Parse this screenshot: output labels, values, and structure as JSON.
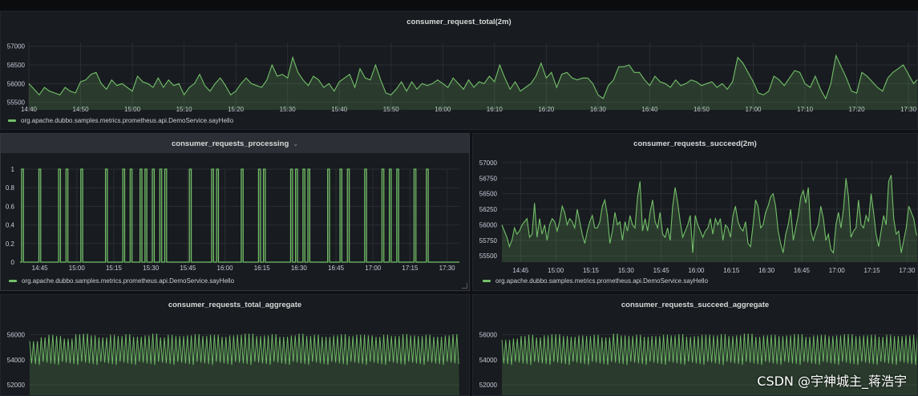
{
  "colors": {
    "series": "#73bf69",
    "fill": "rgba(115,191,105,0.20)",
    "background": "#111217",
    "panel": "#181b1f",
    "grid": "#2a2d33",
    "tick": "#ccccdc"
  },
  "legend_series": "org.apache.dubbo.samples.metrics.prometheus.api.DemoService.sayHello",
  "panel_menu_icon": "chevron-down-icon",
  "watermark": "CSDN @宇神城主_蒋浩宇",
  "chart_data": [
    {
      "id": "total",
      "type": "area",
      "title": "consumer_request_total(2m)",
      "xlabel": "",
      "ylabel": "",
      "x_ticks": [
        "14:40",
        "14:50",
        "15:00",
        "15:10",
        "15:20",
        "15:30",
        "15:40",
        "15:50",
        "16:00",
        "16:10",
        "16:20",
        "16:30",
        "16:40",
        "16:50",
        "17:00",
        "17:10",
        "17:20",
        "17:30"
      ],
      "y_ticks": [
        "55500",
        "56000",
        "56500",
        "57000"
      ],
      "ylim": [
        55300,
        57100
      ],
      "grid": true,
      "legend": "bottom-left",
      "series": [
        {
          "name": "org.apache.dubbo.samples.metrics.prometheus.api.DemoService.sayHello",
          "x_start": "14:40",
          "x_end": "17:32",
          "values": [
            56000,
            55850,
            55700,
            55900,
            55800,
            55750,
            55700,
            55900,
            55800,
            55750,
            56050,
            56100,
            56250,
            56300,
            56000,
            55850,
            56100,
            55950,
            56000,
            55900,
            55800,
            56200,
            56050,
            56000,
            55900,
            56150,
            55900,
            56100,
            55950,
            56000,
            55700,
            55900,
            56000,
            56250,
            55950,
            55800,
            56000,
            56150,
            55950,
            55700,
            55800,
            56000,
            56150,
            56000,
            55950,
            55900,
            56100,
            56500,
            56200,
            56250,
            56150,
            56700,
            56300,
            56100,
            55950,
            56200,
            56100,
            55900,
            56000,
            55800,
            56050,
            56150,
            56250,
            55900,
            56400,
            56150,
            56100,
            56500,
            56100,
            55750,
            55700,
            55850,
            56050,
            55800,
            56050,
            55850,
            56000,
            55950,
            56000,
            56100,
            56000,
            55900,
            56150,
            56000,
            55850,
            56100,
            55900,
            56050,
            56000,
            56200,
            56050,
            56500,
            56150,
            55850,
            56050,
            55800,
            55900,
            56000,
            56200,
            56550,
            56150,
            56300,
            55900,
            56250,
            56300,
            56150,
            56100,
            56150,
            56150,
            56000,
            55700,
            55600,
            55950,
            56100,
            56450,
            56450,
            56500,
            56300,
            56300,
            56100,
            55950,
            56200,
            56050,
            56000,
            55900,
            56100,
            55950,
            56000,
            56100,
            56050,
            55950,
            56000,
            56050,
            55900,
            56000,
            55850,
            56050,
            56700,
            56550,
            56300,
            56050,
            55750,
            55700,
            55800,
            56200,
            56100,
            55950,
            56150,
            56350,
            56300,
            56000,
            55900,
            56200,
            55850,
            55600,
            56000,
            56750,
            56450,
            56150,
            55800,
            55750,
            56300,
            56200,
            56050,
            55900,
            55800,
            56150,
            56300,
            56400,
            56500,
            56250,
            56000,
            56150
          ]
        }
      ]
    },
    {
      "id": "processing",
      "type": "line",
      "title": "consumer_requests_processing",
      "xlabel": "",
      "ylabel": "",
      "x_ticks": [
        "14:45",
        "15:00",
        "15:15",
        "15:30",
        "15:45",
        "16:00",
        "16:15",
        "16:30",
        "16:45",
        "17:00",
        "17:15",
        "17:30"
      ],
      "y_ticks": [
        "0",
        "0.2",
        "0.4",
        "0.6",
        "0.8",
        "1"
      ],
      "ylim": [
        0,
        1
      ],
      "grid": true,
      "legend": "bottom-left",
      "series": [
        {
          "name": "org.apache.dubbo.samples.metrics.prometheus.api.DemoService.sayHello",
          "x_start": "14:37",
          "x_end": "17:35",
          "spike_times": [
            "14:38",
            "14:45",
            "14:53",
            "14:56",
            "15:02",
            "15:12",
            "15:19",
            "15:22",
            "15:26",
            "15:28",
            "15:31",
            "15:34",
            "15:36",
            "15:46",
            "15:55",
            "15:57",
            "16:07",
            "16:14",
            "16:16",
            "16:27",
            "16:29",
            "16:32",
            "16:34",
            "16:42",
            "16:47",
            "16:50",
            "16:57",
            "17:04",
            "17:07",
            "17:10",
            "17:17",
            "17:22"
          ],
          "values": [
            1,
            1,
            1,
            1,
            1,
            1,
            1,
            1,
            1,
            1,
            1,
            1,
            1,
            1,
            1,
            1,
            1,
            1,
            1,
            1,
            1,
            1,
            1,
            1,
            1,
            1,
            1,
            1,
            1,
            1,
            1,
            1
          ],
          "baseline": 0
        }
      ]
    },
    {
      "id": "succeed",
      "type": "area",
      "title": "consumer_requests_succeed(2m)",
      "xlabel": "",
      "ylabel": "",
      "x_ticks": [
        "14:45",
        "15:00",
        "15:15",
        "15:30",
        "15:45",
        "16:00",
        "16:15",
        "16:30",
        "16:45",
        "17:00",
        "17:15",
        "17:30"
      ],
      "y_ticks": [
        "55500",
        "55750",
        "56000",
        "56250",
        "56500",
        "56750",
        "57000"
      ],
      "ylim": [
        55400,
        57050
      ],
      "grid": true,
      "legend": "bottom-left",
      "series": [
        {
          "name": "org.apache.dubbo.samples.metrics.prometheus.api.DemoService.sayHello",
          "x_start": "14:37",
          "x_end": "17:35",
          "values": [
            56000,
            55900,
            55800,
            55650,
            55750,
            55950,
            55850,
            55900,
            56000,
            56050,
            56100,
            55800,
            55850,
            56350,
            55800,
            56100,
            55850,
            56000,
            55750,
            56000,
            56100,
            56050,
            55900,
            56050,
            56300,
            56200,
            56000,
            56100,
            56050,
            55950,
            56250,
            56050,
            55850,
            55700,
            55900,
            56050,
            56150,
            55950,
            55950,
            56050,
            56300,
            56400,
            56150,
            55700,
            55900,
            56200,
            56000,
            56050,
            55750,
            56050,
            55900,
            56150,
            56000,
            55950,
            56450,
            56700,
            55900,
            56100,
            55900,
            56200,
            56400,
            56050,
            55950,
            56200,
            55850,
            55800,
            55950,
            55750,
            56300,
            56600,
            56350,
            56050,
            55800,
            55900,
            56000,
            56150,
            55550,
            56150,
            56000,
            55900,
            55800,
            55900,
            55950,
            56100,
            55850,
            56100,
            56000,
            56100,
            55750,
            56000,
            55950,
            55800,
            56150,
            56300,
            56050,
            55950,
            55900,
            56050,
            55700,
            55650,
            56000,
            56400,
            56300,
            55950,
            56000,
            56200,
            56300,
            56450,
            56500,
            56300,
            55900,
            55700,
            55550,
            55850,
            56000,
            56250,
            55750,
            55950,
            56150,
            56450,
            56550,
            56350,
            56600,
            55900,
            55750,
            55900,
            56000,
            56300,
            56100,
            55750,
            55850,
            55600,
            55550,
            56000,
            56200,
            55950,
            56250,
            56750,
            56450,
            55800,
            55900,
            55950,
            56400,
            56000,
            55950,
            56150,
            56050,
            56500,
            56200,
            55850,
            55650,
            55900,
            56150,
            56000,
            56700,
            56800,
            56100,
            55850,
            55900,
            55550,
            55750,
            55950,
            56300,
            56200,
            56100,
            55850,
            55800
          ]
        }
      ]
    },
    {
      "id": "total_agg",
      "type": "area",
      "title": "consumer_requests_total_aggregate",
      "xlabel": "",
      "ylabel": "",
      "y_ticks": [
        "52000",
        "54000",
        "56000"
      ],
      "ylim": [
        51500,
        57000
      ],
      "grid": true,
      "series": [
        {
          "pattern": "dense-oscillation",
          "low": 53600,
          "high": 56100,
          "envelope": [
            55500,
            55800,
            56000,
            55900,
            55700,
            56050,
            56100,
            55950,
            55800,
            56000,
            55900,
            56050,
            55850,
            55950,
            56100,
            55800,
            56000,
            55900,
            55950,
            56050,
            55900,
            56000,
            55850,
            55950,
            56000,
            56100,
            55900,
            55950,
            56050,
            55850,
            55950,
            56100,
            55900,
            56000,
            55850,
            55950,
            56050,
            55900,
            56000,
            55950,
            55850,
            56000,
            55900,
            56050,
            55950,
            55900,
            56000,
            55850,
            55950,
            56050
          ]
        }
      ]
    },
    {
      "id": "succeed_agg",
      "type": "area",
      "title": "consumer_requests_succeed_aggregate",
      "xlabel": "",
      "ylabel": "",
      "y_ticks": [
        "52000",
        "54000",
        "56000"
      ],
      "ylim": [
        51500,
        57000
      ],
      "grid": true,
      "series": [
        {
          "pattern": "dense-oscillation",
          "low": 53600,
          "high": 56100,
          "envelope": [
            55600,
            55700,
            55900,
            56000,
            55800,
            55950,
            56050,
            55900,
            55850,
            55950,
            55900,
            56000,
            55800,
            56100,
            55950,
            55900,
            56000,
            55850,
            55900,
            56000,
            55950,
            56050,
            55850,
            55900,
            56000,
            55950,
            56050,
            55900,
            55950,
            56100,
            55850,
            55950,
            56000,
            55900,
            55950,
            56050,
            55850,
            55950,
            56000,
            55900,
            55950,
            56050,
            55900,
            55950,
            56000,
            55850,
            56000,
            55900,
            55950,
            56000
          ]
        }
      ]
    }
  ]
}
